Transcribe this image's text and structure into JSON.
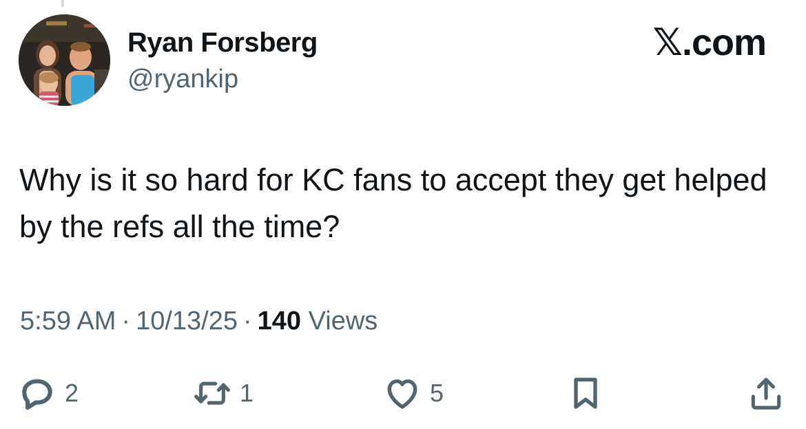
{
  "header": {
    "display_name": "Ryan Forsberg",
    "handle": "@ryankip",
    "brand": "𝕏.com"
  },
  "tweet": {
    "text": "Why is it so hard for KC fans to accept they get helped by the refs all the time?"
  },
  "meta": {
    "time": "5:59 AM",
    "date": "10/13/25",
    "separator": "·",
    "views_count": "140",
    "views_label": "Views"
  },
  "actions": {
    "reply_count": "2",
    "repost_count": "1",
    "like_count": "5"
  },
  "icons": {
    "reply": "reply-icon",
    "repost": "repost-icon",
    "like": "heart-icon",
    "bookmark": "bookmark-icon",
    "share": "share-icon"
  },
  "colors": {
    "text_primary": "#0f1419",
    "text_secondary": "#536471",
    "background": "#ffffff"
  }
}
